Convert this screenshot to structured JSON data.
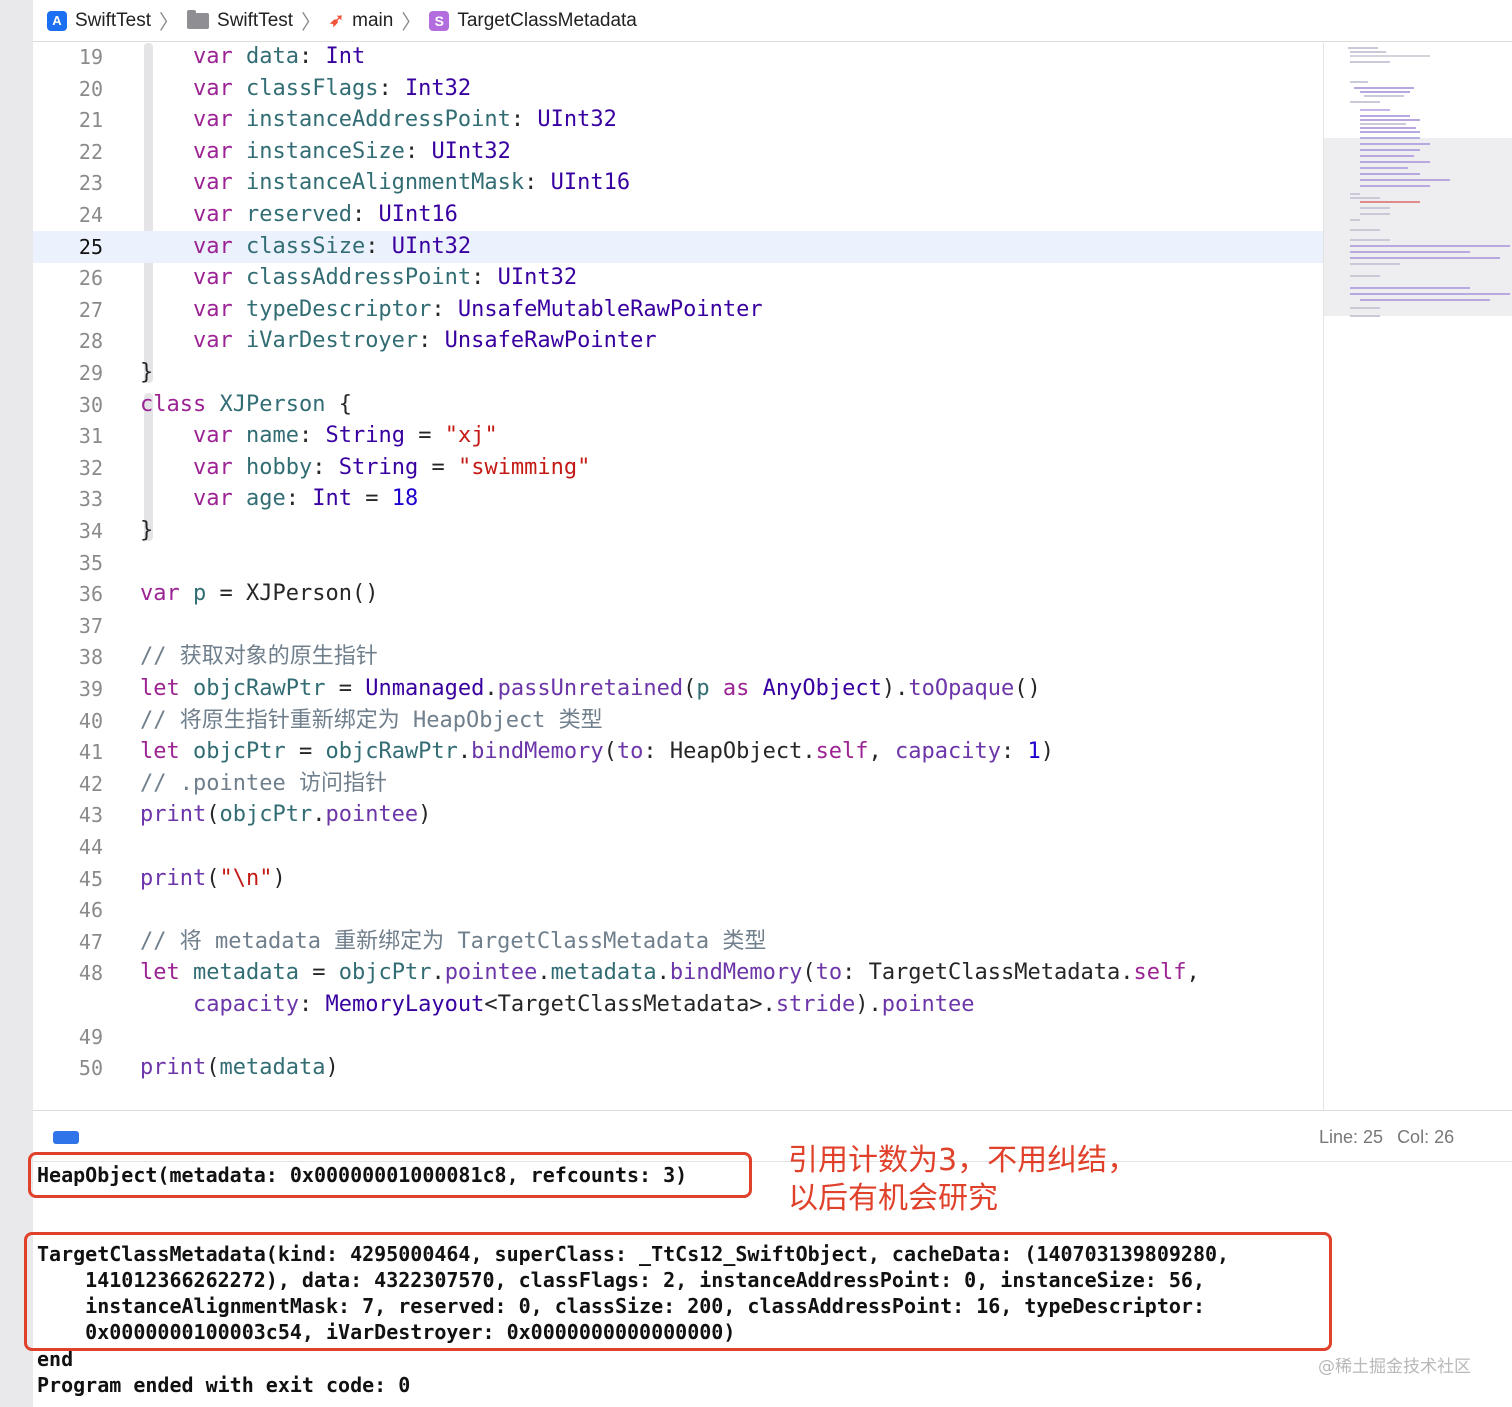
{
  "breadcrumb": {
    "project": "SwiftTest",
    "folder": "SwiftTest",
    "file": "main",
    "symbol": "TargetClassMetadata"
  },
  "editor": {
    "current_line": 25,
    "lines": [
      {
        "n": "19",
        "tokens": [
          [
            "",
            "    "
          ],
          [
            "kw",
            "var"
          ],
          [
            "",
            " "
          ],
          [
            "id",
            "data"
          ],
          [
            "",
            ": "
          ],
          [
            "ty",
            "Int"
          ]
        ]
      },
      {
        "n": "20",
        "tokens": [
          [
            "",
            "    "
          ],
          [
            "kw",
            "var"
          ],
          [
            "",
            " "
          ],
          [
            "id",
            "classFlags"
          ],
          [
            "",
            ": "
          ],
          [
            "ty",
            "Int32"
          ]
        ]
      },
      {
        "n": "21",
        "tokens": [
          [
            "",
            "    "
          ],
          [
            "kw",
            "var"
          ],
          [
            "",
            " "
          ],
          [
            "id",
            "instanceAddressPoint"
          ],
          [
            "",
            ": "
          ],
          [
            "ty",
            "UInt32"
          ]
        ]
      },
      {
        "n": "22",
        "tokens": [
          [
            "",
            "    "
          ],
          [
            "kw",
            "var"
          ],
          [
            "",
            " "
          ],
          [
            "id",
            "instanceSize"
          ],
          [
            "",
            ": "
          ],
          [
            "ty",
            "UInt32"
          ]
        ]
      },
      {
        "n": "23",
        "tokens": [
          [
            "",
            "    "
          ],
          [
            "kw",
            "var"
          ],
          [
            "",
            " "
          ],
          [
            "id",
            "instanceAlignmentMask"
          ],
          [
            "",
            ": "
          ],
          [
            "ty",
            "UInt16"
          ]
        ]
      },
      {
        "n": "24",
        "tokens": [
          [
            "",
            "    "
          ],
          [
            "kw",
            "var"
          ],
          [
            "",
            " "
          ],
          [
            "id",
            "reserved"
          ],
          [
            "",
            ": "
          ],
          [
            "ty",
            "UInt16"
          ]
        ]
      },
      {
        "n": "25",
        "tokens": [
          [
            "",
            "    "
          ],
          [
            "kw",
            "var"
          ],
          [
            "",
            " "
          ],
          [
            "id",
            "classSize"
          ],
          [
            "",
            ": "
          ],
          [
            "ty",
            "UInt32"
          ]
        ]
      },
      {
        "n": "26",
        "tokens": [
          [
            "",
            "    "
          ],
          [
            "kw",
            "var"
          ],
          [
            "",
            " "
          ],
          [
            "id",
            "classAddressPoint"
          ],
          [
            "",
            ": "
          ],
          [
            "ty",
            "UInt32"
          ]
        ]
      },
      {
        "n": "27",
        "tokens": [
          [
            "",
            "    "
          ],
          [
            "kw",
            "var"
          ],
          [
            "",
            " "
          ],
          [
            "id",
            "typeDescriptor"
          ],
          [
            "",
            ": "
          ],
          [
            "ty",
            "UnsafeMutableRawPointer"
          ]
        ]
      },
      {
        "n": "28",
        "tokens": [
          [
            "",
            "    "
          ],
          [
            "kw",
            "var"
          ],
          [
            "",
            " "
          ],
          [
            "id",
            "iVarDestroyer"
          ],
          [
            "",
            ": "
          ],
          [
            "ty",
            "UnsafeRawPointer"
          ]
        ]
      },
      {
        "n": "29",
        "tokens": [
          [
            "",
            "}"
          ]
        ]
      },
      {
        "n": "30",
        "tokens": [
          [
            "kw",
            "class"
          ],
          [
            "",
            " "
          ],
          [
            "id",
            "XJPerson"
          ],
          [
            "",
            " {"
          ]
        ]
      },
      {
        "n": "31",
        "tokens": [
          [
            "",
            "    "
          ],
          [
            "kw",
            "var"
          ],
          [
            "",
            " "
          ],
          [
            "id",
            "name"
          ],
          [
            "",
            ": "
          ],
          [
            "ty",
            "String"
          ],
          [
            "",
            " = "
          ],
          [
            "str",
            "\"xj\""
          ]
        ]
      },
      {
        "n": "32",
        "tokens": [
          [
            "",
            "    "
          ],
          [
            "kw",
            "var"
          ],
          [
            "",
            " "
          ],
          [
            "id",
            "hobby"
          ],
          [
            "",
            ": "
          ],
          [
            "ty",
            "String"
          ],
          [
            "",
            " = "
          ],
          [
            "str",
            "\"swimming\""
          ]
        ]
      },
      {
        "n": "33",
        "tokens": [
          [
            "",
            "    "
          ],
          [
            "kw",
            "var"
          ],
          [
            "",
            " "
          ],
          [
            "id",
            "age"
          ],
          [
            "",
            ": "
          ],
          [
            "ty",
            "Int"
          ],
          [
            "",
            " = "
          ],
          [
            "num",
            "18"
          ]
        ]
      },
      {
        "n": "34",
        "tokens": [
          [
            "",
            "}"
          ]
        ]
      },
      {
        "n": "35",
        "tokens": []
      },
      {
        "n": "36",
        "tokens": [
          [
            "kw",
            "var"
          ],
          [
            "",
            " "
          ],
          [
            "id",
            "p"
          ],
          [
            "",
            " = XJPerson()"
          ]
        ]
      },
      {
        "n": "37",
        "tokens": []
      },
      {
        "n": "38",
        "tokens": [
          [
            "cm",
            "// 获取对象的原生指针"
          ]
        ]
      },
      {
        "n": "39",
        "tokens": [
          [
            "kw",
            "let"
          ],
          [
            "",
            " "
          ],
          [
            "id",
            "objcRawPtr"
          ],
          [
            "",
            " = "
          ],
          [
            "ty",
            "Unmanaged"
          ],
          [
            "",
            "."
          ],
          [
            "fn",
            "passUnretained"
          ],
          [
            "",
            "("
          ],
          [
            "id",
            "p"
          ],
          [
            "",
            " "
          ],
          [
            "kw",
            "as"
          ],
          [
            "",
            " "
          ],
          [
            "ty",
            "AnyObject"
          ],
          [
            "",
            ")."
          ],
          [
            "fn",
            "toOpaque"
          ],
          [
            "",
            "()"
          ]
        ]
      },
      {
        "n": "40",
        "tokens": [
          [
            "cm",
            "// 将原生指针重新绑定为 HeapObject 类型"
          ]
        ]
      },
      {
        "n": "41",
        "tokens": [
          [
            "kw",
            "let"
          ],
          [
            "",
            " "
          ],
          [
            "id",
            "objcPtr"
          ],
          [
            "",
            " = "
          ],
          [
            "id",
            "objcRawPtr"
          ],
          [
            "",
            "."
          ],
          [
            "fn",
            "bindMemory"
          ],
          [
            "",
            "("
          ],
          [
            "fn",
            "to"
          ],
          [
            "",
            ": HeapObject."
          ],
          [
            "kw",
            "self"
          ],
          [
            "",
            ", "
          ],
          [
            "fn",
            "capacity"
          ],
          [
            "",
            ": "
          ],
          [
            "num",
            "1"
          ],
          [
            "",
            ")"
          ]
        ]
      },
      {
        "n": "42",
        "tokens": [
          [
            "cm",
            "// .pointee 访问指针"
          ]
        ]
      },
      {
        "n": "43",
        "tokens": [
          [
            "fn",
            "print"
          ],
          [
            "",
            "("
          ],
          [
            "id",
            "objcPtr"
          ],
          [
            "",
            "."
          ],
          [
            "fn",
            "pointee"
          ],
          [
            "",
            ")"
          ]
        ]
      },
      {
        "n": "44",
        "tokens": []
      },
      {
        "n": "45",
        "tokens": [
          [
            "fn",
            "print"
          ],
          [
            "",
            "("
          ],
          [
            "str",
            "\"\\n\""
          ],
          [
            "",
            ")"
          ]
        ]
      },
      {
        "n": "46",
        "tokens": []
      },
      {
        "n": "47",
        "tokens": [
          [
            "cm",
            "// 将 metadata 重新绑定为 TargetClassMetadata 类型"
          ]
        ]
      },
      {
        "n": "48",
        "tokens": [
          [
            "kw",
            "let"
          ],
          [
            "",
            " "
          ],
          [
            "id",
            "metadata"
          ],
          [
            "",
            " = "
          ],
          [
            "id",
            "objcPtr"
          ],
          [
            "",
            "."
          ],
          [
            "fn",
            "pointee"
          ],
          [
            "",
            "."
          ],
          [
            "id",
            "metadata"
          ],
          [
            "",
            "."
          ],
          [
            "fn",
            "bindMemory"
          ],
          [
            "",
            "("
          ],
          [
            "fn",
            "to"
          ],
          [
            "",
            ": TargetClassMetadata."
          ],
          [
            "kw",
            "self"
          ],
          [
            "",
            ","
          ]
        ]
      },
      {
        "n": "",
        "tokens": [
          [
            "",
            "    "
          ],
          [
            "fn",
            "capacity"
          ],
          [
            "",
            ": "
          ],
          [
            "ty",
            "MemoryLayout"
          ],
          [
            "",
            "<TargetClassMetadata>."
          ],
          [
            "fn",
            "stride"
          ],
          [
            "",
            ")."
          ],
          [
            "fn",
            "pointee"
          ]
        ]
      },
      {
        "n": "49",
        "tokens": []
      },
      {
        "n": "50",
        "tokens": [
          [
            "fn",
            "print"
          ],
          [
            "",
            "("
          ],
          [
            "id",
            "metadata"
          ],
          [
            "",
            ")"
          ]
        ]
      }
    ]
  },
  "status": {
    "line": "Line: 25",
    "col": "Col: 26"
  },
  "console": {
    "heap_line": "HeapObject(metadata: 0x00000001000081c8, refcounts: 3)",
    "metadata_lines": [
      "TargetClassMetadata(kind: 4295000464, superClass: _TtCs12_SwiftObject, cacheData: (140703139809280,",
      "    141012366262272), data: 4322307570, classFlags: 2, instanceAddressPoint: 0, instanceSize: 56,",
      "    instanceAlignmentMask: 7, reserved: 0, classSize: 200, classAddressPoint: 16, typeDescriptor:",
      "    0x0000000100003c54, iVarDestroyer: 0x0000000000000000)"
    ],
    "end_line": "end",
    "exit_line": "Program ended with exit code: 0"
  },
  "annotation": {
    "line1": "引用计数为3，不用纠结，",
    "line2": "以后有机会研究"
  },
  "watermark": "@稀土掘金技术社区",
  "colors": {
    "keyword": "#9b2393",
    "type": "#3900a0",
    "identifier": "#326d74",
    "function": "#6c36a9",
    "string": "#c41a16",
    "number": "#1c00cf",
    "comment": "#707f8c",
    "annotation_red": "#e0412b",
    "current_line_bg": "#ecf2fd"
  }
}
